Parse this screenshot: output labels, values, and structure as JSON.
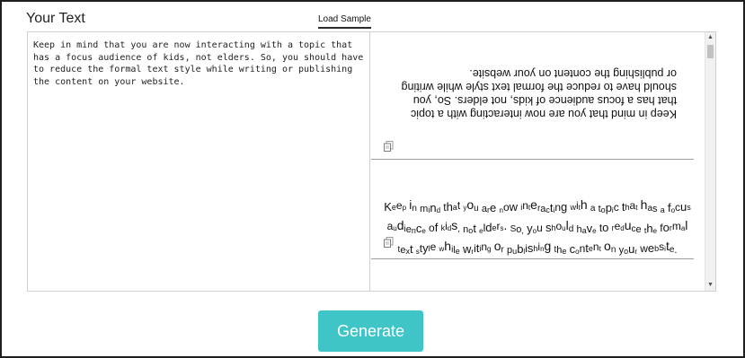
{
  "header": {
    "title": "Your Text",
    "load_sample_label": "Load Sample"
  },
  "input": {
    "value": "Keep in mind that you are now interacting with a topic that has a focus audience of kids, not elders. So, you should have to reduce the formal text style while writing or publishing the content on your website."
  },
  "results": [
    {
      "style": "upside-down",
      "text": "Keep in mind that you are now interacting with a topic that has a focus audience of kids, not elders. So, you should have to reduce the formal text style while writing or publishing the content on your website."
    },
    {
      "style": "mixed-size",
      "text": "Keep in mind that you are now interacting with a topic that has a focus audience of kids, not elders. So, you should have to reduce the formal text style while writing or publishing the content on your website."
    }
  ],
  "icons": {
    "copy": "copy-icon",
    "scroll_up": "scroll-up-arrow-icon",
    "scroll_down": "scroll-down-arrow-icon"
  },
  "actions": {
    "generate_label": "Generate"
  },
  "colors": {
    "accent": "#3fc5c8",
    "border": "#cfcfcf",
    "frame": "#1f1f1f"
  }
}
